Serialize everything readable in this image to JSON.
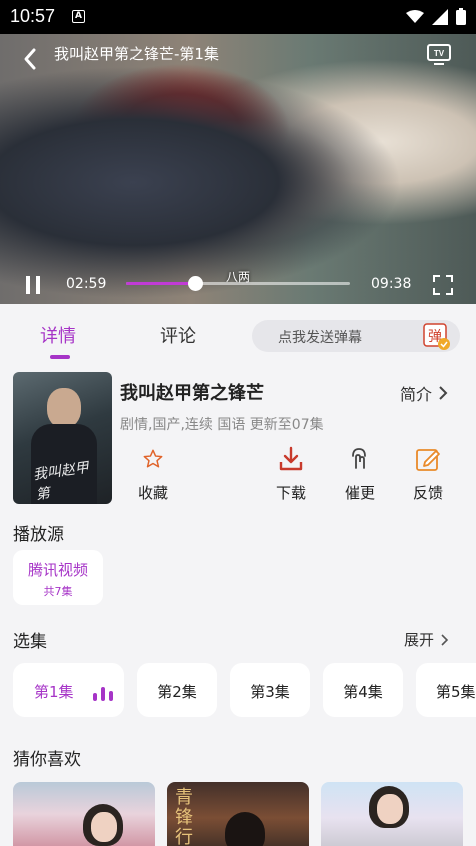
{
  "status_bar": {
    "time": "10:57",
    "notification_icon": "A"
  },
  "player": {
    "title": "我叫赵甲第之锋芒-第1集",
    "subtitle_text": "八两",
    "current_time": "02:59",
    "total_time": "09:38",
    "progress": 0.31,
    "accent_color": "#c13bd6"
  },
  "tabs": {
    "detail": "详情",
    "comments": "评论",
    "danmaku_placeholder": "点我发送弹幕",
    "danmaku_icon_text": "弹"
  },
  "show": {
    "title": "我叫赵甲第之锋芒",
    "intro_label": "简介",
    "meta": "剧情,国产,连续 国语 更新至07集",
    "poster_text": "我叫赵甲第"
  },
  "actions": [
    {
      "label": "收藏",
      "icon": "star-icon"
    },
    {
      "label": "下载",
      "icon": "download-icon"
    },
    {
      "label": "催更",
      "icon": "touch-icon"
    },
    {
      "label": "反馈",
      "icon": "edit-icon"
    }
  ],
  "source": {
    "section_title": "播放源",
    "name": "腾讯视频",
    "count": "共7集"
  },
  "episodes": {
    "section_title": "选集",
    "expand_label": "展开",
    "items": [
      "第1集",
      "第2集",
      "第3集",
      "第4集",
      "第5集"
    ],
    "active_index": 0
  },
  "recommend": {
    "section_title": "猜你喜欢",
    "item2_text": "青锋行"
  },
  "colors": {
    "accent": "#a634c7",
    "download": "#c83a2c",
    "star": "#e0632a",
    "feedback": "#e98a2a"
  }
}
